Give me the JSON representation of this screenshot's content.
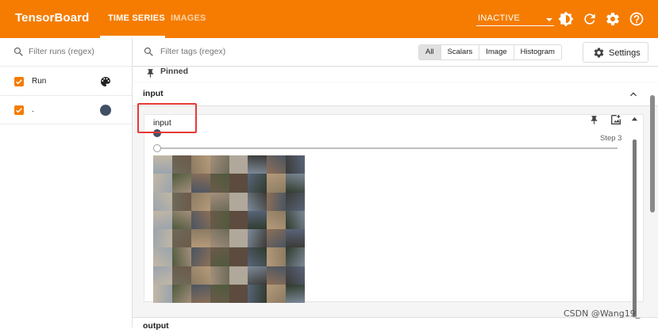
{
  "app": {
    "title": "TensorBoard",
    "accent_color": "#f57c00"
  },
  "nav": {
    "tabs": [
      {
        "label": "TIME SERIES",
        "active": true
      },
      {
        "label": "IMAGES",
        "active": false
      }
    ],
    "reload_select": {
      "value": "INACTIVE"
    },
    "icons": [
      "theme-icon",
      "refresh-icon",
      "settings-gear-icon",
      "help-icon"
    ]
  },
  "sidebar": {
    "filter_placeholder": "Filter runs (regex)",
    "header_label": "Run",
    "runs": [
      {
        "name": ".",
        "checked": true,
        "color": "#425066"
      }
    ]
  },
  "toolbar": {
    "filter_placeholder": "Filter tags (regex)",
    "segments": [
      {
        "label": "All",
        "selected": true
      },
      {
        "label": "Scalars",
        "selected": false
      },
      {
        "label": "Image",
        "selected": false
      },
      {
        "label": "Histogram",
        "selected": false
      }
    ],
    "settings_label": "Settings"
  },
  "pinned": {
    "label": "Pinned"
  },
  "groups": [
    {
      "name": "input",
      "card": {
        "title": "input",
        "step_label": "Step 3"
      }
    },
    {
      "name": "output"
    }
  ],
  "watermark": "CSDN @Wang19_"
}
